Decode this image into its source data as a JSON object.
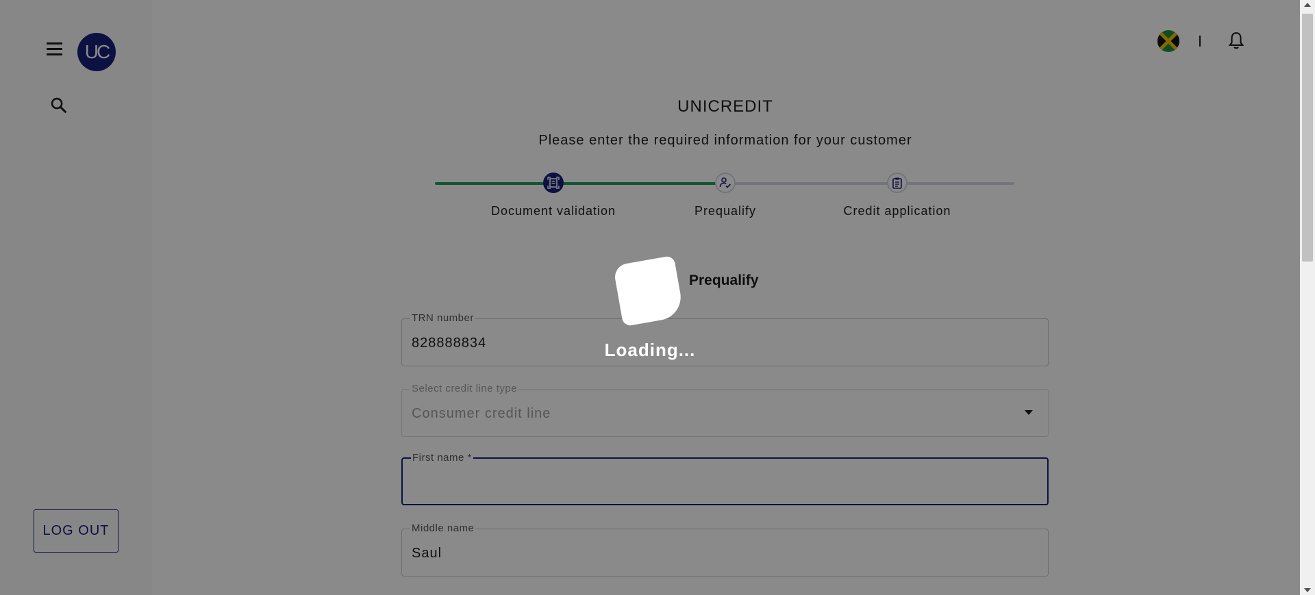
{
  "sidebar": {
    "avatar_text": "UC",
    "menu_icon": "hamburger-menu-icon",
    "search_icon": "search-icon",
    "logout_label": "LOG OUT"
  },
  "header": {
    "flag_icon": "jamaica-flag-icon",
    "divider_text": "|",
    "bell_icon": "bell-icon"
  },
  "main": {
    "title": "UNICREDIT",
    "subtitle": "Please enter the required information for your customer",
    "steps": [
      {
        "label": "Document validation",
        "status": "complete",
        "icon": "document-scan-icon"
      },
      {
        "label": "Prequalify",
        "status": "current",
        "icon": "person-check-icon"
      },
      {
        "label": "Credit application",
        "status": "pending",
        "icon": "clipboard-icon"
      }
    ],
    "section_title": "Prequalify",
    "fields": {
      "trn": {
        "label": "TRN number",
        "value": "828888834"
      },
      "credit_line": {
        "label": "Select credit line type",
        "value": "Consumer credit line"
      },
      "first_name": {
        "label": "First name *",
        "value": ""
      },
      "middle_name": {
        "label": "Middle name",
        "value": "Saul"
      }
    }
  },
  "overlay": {
    "loading_text": "Loading..."
  },
  "colors": {
    "brand": "#18217b",
    "progress": "#1fa05b",
    "track": "#d5d5e8"
  }
}
